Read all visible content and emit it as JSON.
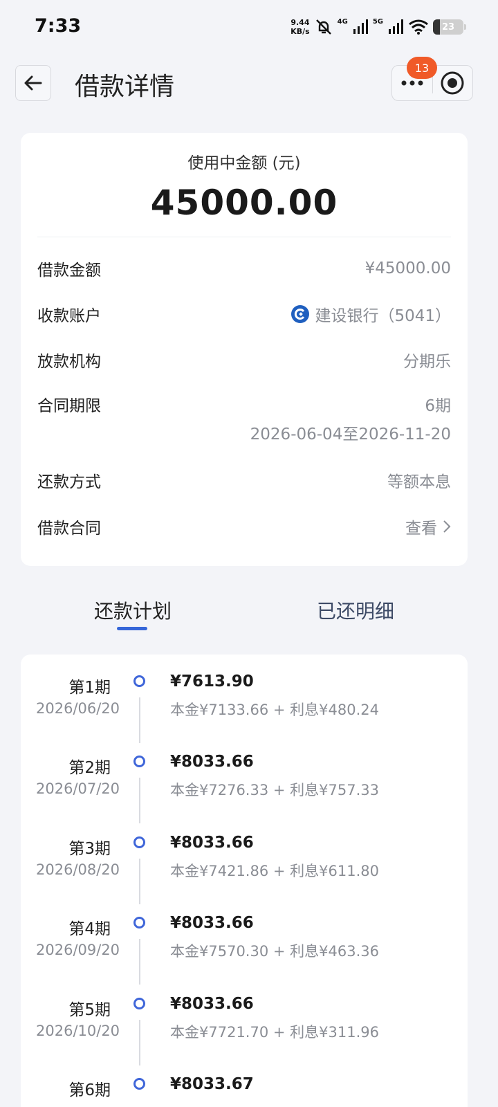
{
  "status_bar": {
    "time": "7:33",
    "speed_value": "9.44",
    "speed_unit": "KB/s",
    "net1": "4G",
    "net2": "5G",
    "battery": "23",
    "battery_level": 0.23
  },
  "header": {
    "title": "借款详情",
    "badge_count": "13"
  },
  "summary": {
    "label": "使用中金额 (元)",
    "amount": "45000.00",
    "rows": {
      "loan_amount": {
        "label": "借款金额",
        "value": "¥45000.00"
      },
      "account": {
        "label": "收款账户",
        "value": "建设银行（5041）"
      },
      "institution": {
        "label": "放款机构",
        "value": "分期乐"
      },
      "term": {
        "label": "合同期限",
        "value": "6期",
        "dates": "2026-06-04至2026-11-20"
      },
      "method": {
        "label": "还款方式",
        "value": "等额本息"
      },
      "contract": {
        "label": "借款合同",
        "value": "查看"
      }
    }
  },
  "tabs": {
    "plan": "还款计划",
    "paid": "已还明细"
  },
  "schedule": [
    {
      "period": "第1期",
      "date": "2026/06/20",
      "amount": "¥7613.90",
      "detail": "本金¥7133.66 + 利息¥480.24"
    },
    {
      "period": "第2期",
      "date": "2026/07/20",
      "amount": "¥8033.66",
      "detail": "本金¥7276.33 + 利息¥757.33"
    },
    {
      "period": "第3期",
      "date": "2026/08/20",
      "amount": "¥8033.66",
      "detail": "本金¥7421.86 + 利息¥611.80"
    },
    {
      "period": "第4期",
      "date": "2026/09/20",
      "amount": "¥8033.66",
      "detail": "本金¥7570.30 + 利息¥463.36"
    },
    {
      "period": "第5期",
      "date": "2026/10/20",
      "amount": "¥8033.66",
      "detail": "本金¥7721.70 + 利息¥311.96"
    },
    {
      "period": "第6期",
      "date": "",
      "amount": "¥8033.67",
      "detail": ""
    }
  ],
  "colors": {
    "accent": "#3f66d9",
    "badge": "#f05a28",
    "background": "#f3f4f8"
  }
}
